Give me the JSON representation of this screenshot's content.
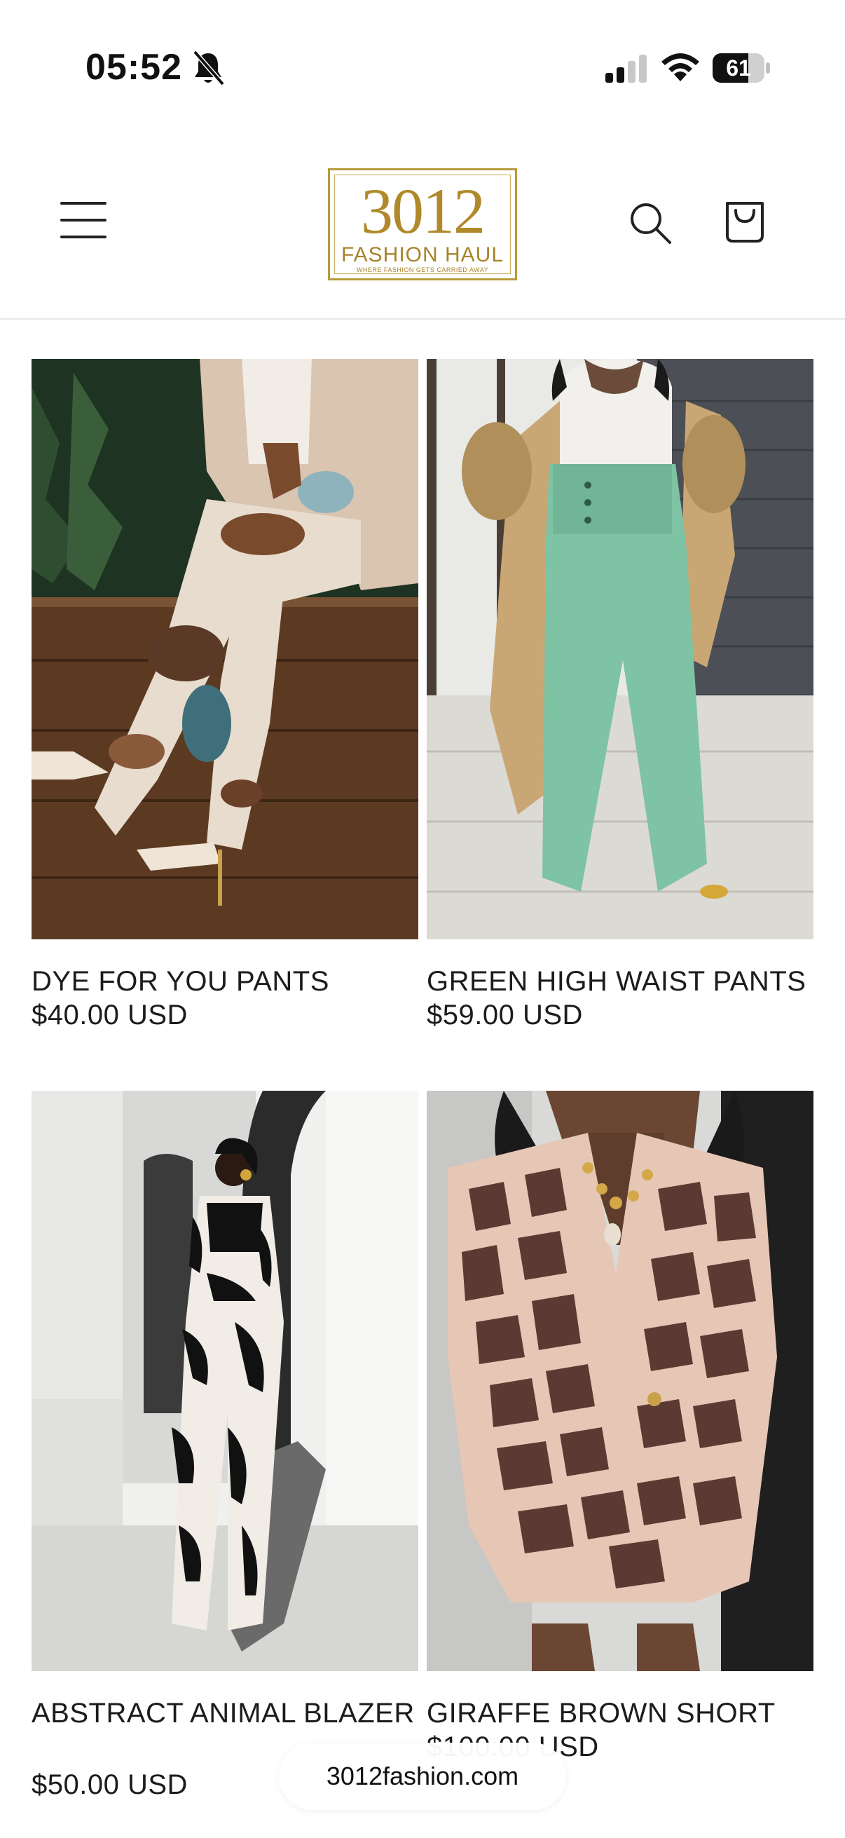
{
  "status_bar": {
    "time": "05:52",
    "battery_level": "61",
    "icons": [
      "bell-slash-icon",
      "cellular-signal-icon",
      "wifi-icon",
      "battery-icon"
    ]
  },
  "header": {
    "logo": {
      "number": "3012",
      "name": "FASHION HAUL",
      "tagline": "WHERE FASHION GETS CARRIED AWAY"
    },
    "icons": [
      "menu-icon",
      "search-icon",
      "cart-icon"
    ]
  },
  "products": [
    {
      "title": "DYE FOR YOU PANTS",
      "price": "$40.00 USD"
    },
    {
      "title": "GREEN HIGH WAIST PANTS",
      "price": "$59.00 USD"
    },
    {
      "title": "ABSTRACT ANIMAL BLAZER",
      "price": "$50.00 USD"
    },
    {
      "title": "GIRAFFE BROWN SHORT",
      "price": "$100.00 USD"
    }
  ],
  "browser": {
    "url": "3012fashion.com"
  },
  "colors": {
    "logo_gold": "#b08a2a",
    "text": "#1c1c1c",
    "divider": "#e6e6e6"
  }
}
